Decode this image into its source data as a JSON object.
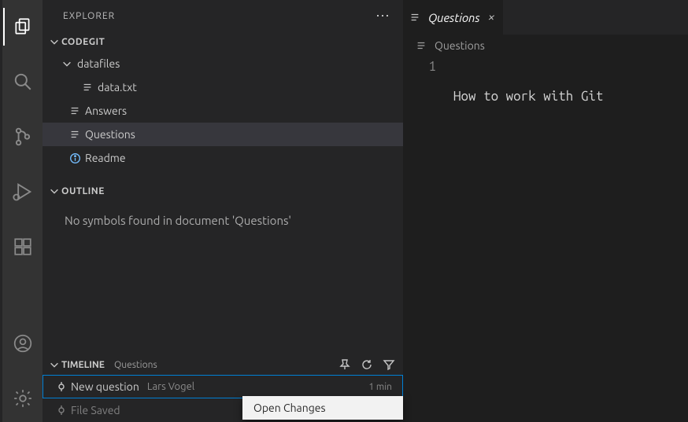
{
  "activity": {
    "items": [
      "explorer",
      "search",
      "source-control",
      "run-debug",
      "extensions"
    ],
    "bottom": [
      "accounts",
      "manage"
    ]
  },
  "sidebar": {
    "title": "EXPLORER",
    "workspace": "CODEGIT",
    "tree": {
      "folder1": "datafiles",
      "file1": "data.txt",
      "file2": "Answers",
      "file3": "Questions",
      "file4": "Readme"
    },
    "outline": {
      "title": "OUTLINE",
      "message": "No symbols found in document 'Questions'"
    },
    "timeline": {
      "title": "TIMELINE",
      "file": "Questions",
      "entries": [
        {
          "label": "New question",
          "author": "Lars Vogel",
          "time": "1 min"
        },
        {
          "label": "File Saved",
          "author": "",
          "time": ""
        }
      ]
    }
  },
  "editor": {
    "tab_name": "Questions",
    "breadcrumb": "Questions",
    "lines": [
      {
        "no": "1",
        "text": "How to work with Git "
      }
    ]
  },
  "contextmenu": {
    "items": [
      "Open Changes"
    ]
  }
}
